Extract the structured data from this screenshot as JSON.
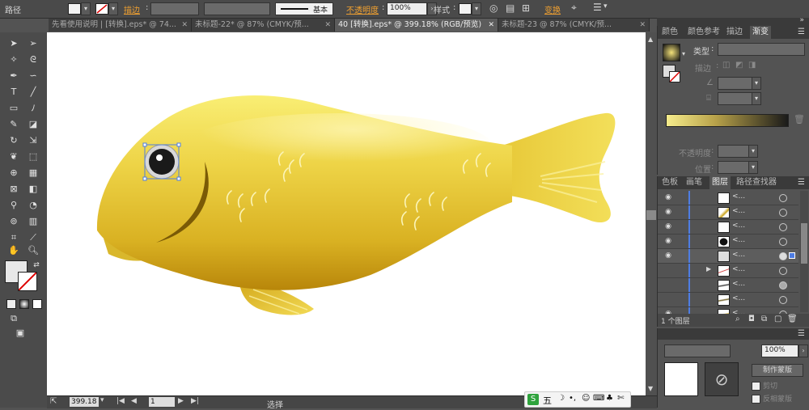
{
  "control_bar": {
    "object_type": "路径",
    "stroke_label": "描边",
    "stroke_style": "基本",
    "opacity_label": "不透明度",
    "opacity_value": "100%",
    "style_label": "样式",
    "transform_label": "变换"
  },
  "tabs": [
    {
      "label": "先看使用说明 | [转换].eps* @ 74...",
      "active": false
    },
    {
      "label": "未标题-22* @ 87% (CMYK/预...",
      "active": false
    },
    {
      "label": "40 [转换].eps* @ 399.18% (RGB/预览)",
      "active": true
    },
    {
      "label": "未标题-23 @ 87% (CMYK/预...",
      "active": false
    }
  ],
  "status_bar": {
    "zoom": "399.18",
    "page": "1",
    "tool": "选择"
  },
  "gradient_panel": {
    "tabs": [
      "颜色",
      "颜色参考",
      "描边",
      "渐变"
    ],
    "active_tab": "渐变",
    "type_label": "类型",
    "stroke_label": "描边",
    "opacity_label": "不透明度",
    "position_label": "位置"
  },
  "layers_panel": {
    "tabs": [
      "色板",
      "画笔",
      "图层",
      "路径查找器"
    ],
    "active_tab": "图层",
    "footer_label": "1 个图层",
    "rows": [
      {
        "name": "<...",
        "visible": true
      },
      {
        "name": "<...",
        "visible": true
      },
      {
        "name": "<...",
        "visible": true
      },
      {
        "name": "<...",
        "visible": true
      },
      {
        "name": "<...",
        "visible": true
      },
      {
        "name": "<...",
        "visible": false
      },
      {
        "name": "<...",
        "visible": false
      },
      {
        "name": "<...",
        "visible": false
      },
      {
        "name": "<...",
        "visible": true
      }
    ]
  },
  "transparency_panel": {
    "opacity_value": "100%",
    "make_mask_label": "制作蒙版",
    "clip_label": "剪切",
    "invert_mask_label": "反相蒙版"
  },
  "ime_bar": {
    "mode": "五"
  },
  "colors": {
    "fish_light": "#f6e35a",
    "fish_dark": "#c89a10",
    "fish_mid": "#e2c230",
    "ui_dark": "#4a4a4a",
    "accent_orange": "#f0a030"
  }
}
